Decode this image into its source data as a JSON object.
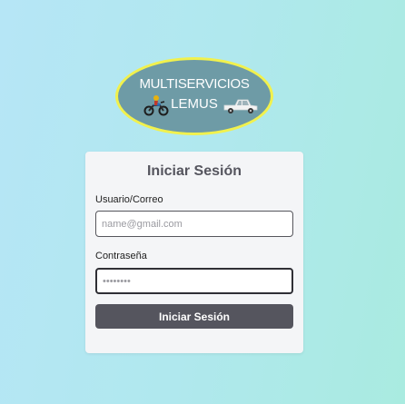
{
  "logo": {
    "line1": "MULTISERVICIOS",
    "line2": "LEMUS",
    "icons": [
      "motorcycle-icon",
      "pickup-truck-icon"
    ],
    "colors": {
      "fill": "#6e9ba6",
      "border": "#f1f14d"
    }
  },
  "login": {
    "title": "Iniciar Sesión",
    "user_label": "Usuario/Correo",
    "user_placeholder": "name@gmail.com",
    "user_value": "",
    "password_label": "Contraseña",
    "password_placeholder": "••••••••",
    "password_value": "",
    "submit_label": "Iniciar Sesión"
  },
  "colors": {
    "button": "#55555e",
    "card": "#f4f5f7",
    "background_start": "#b6e6f6",
    "background_end": "#a9ebe0"
  }
}
